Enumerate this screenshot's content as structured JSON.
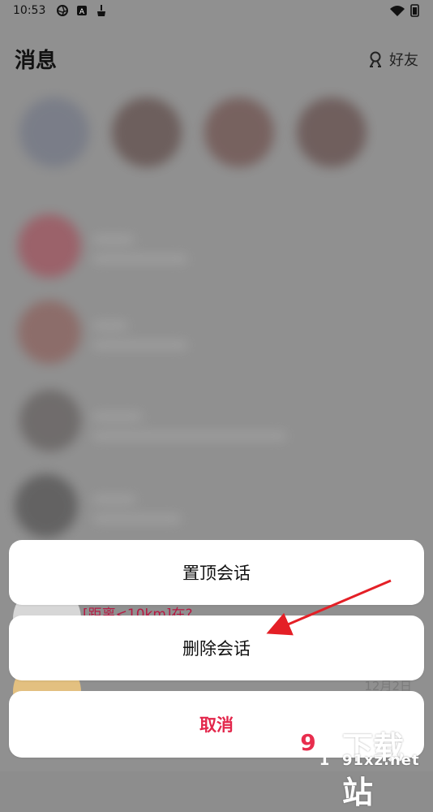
{
  "status_bar": {
    "time": "10:53"
  },
  "header": {
    "title": "消息",
    "friends_label": "好友"
  },
  "visible_peek": {
    "distance_text": "[距离<10km]在?",
    "date_text": "12月2日"
  },
  "action_sheet": {
    "pin_label": "置顶会话",
    "delete_label": "删除会话",
    "cancel_label": "取消"
  },
  "watermark": {
    "top": "下载站",
    "bottom": "91xz.net"
  },
  "colors": {
    "overlay": "#909090",
    "cancel": "#e3264b",
    "arrow": "#e41f26"
  }
}
